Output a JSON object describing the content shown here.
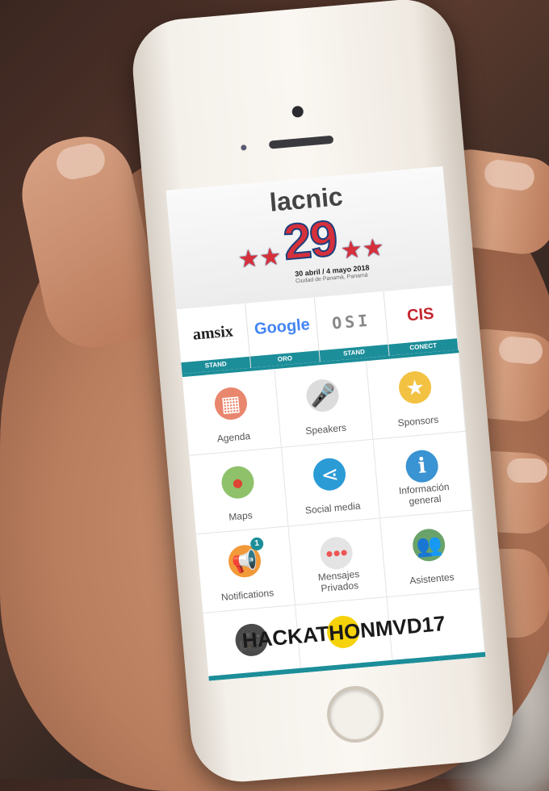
{
  "header": {
    "brand": "lacnic",
    "number": "29",
    "dates": "30 abril / 4 mayo 2018",
    "city": "Ciudad de Panamá, Panamá"
  },
  "sponsors": [
    {
      "logo": "amsix",
      "tag": "STAND"
    },
    {
      "logo": "Google",
      "tag": "ORO"
    },
    {
      "logo": "OSI",
      "tag": "STAND"
    },
    {
      "logo": "CIS",
      "tag": "CONECT"
    }
  ],
  "tiles": {
    "agenda": "Agenda",
    "speakers": "Speakers",
    "sponsors": "Sponsors",
    "maps": "Maps",
    "social": "Social media",
    "info_line1": "Información",
    "info_line2": "general",
    "notifications": "Notifications",
    "notifications_badge": "1",
    "mensajes_line1": "Mensajes",
    "mensajes_line2": "Privados",
    "asistentes": "Asistentes",
    "hack_line1": "HACK",
    "hack_line2": "ATHON",
    "hack_line3": "MVD17"
  },
  "colors": {
    "accent": "#1c8e99",
    "brand_red": "#d6303b",
    "brand_blue": "#1c3f7d"
  }
}
